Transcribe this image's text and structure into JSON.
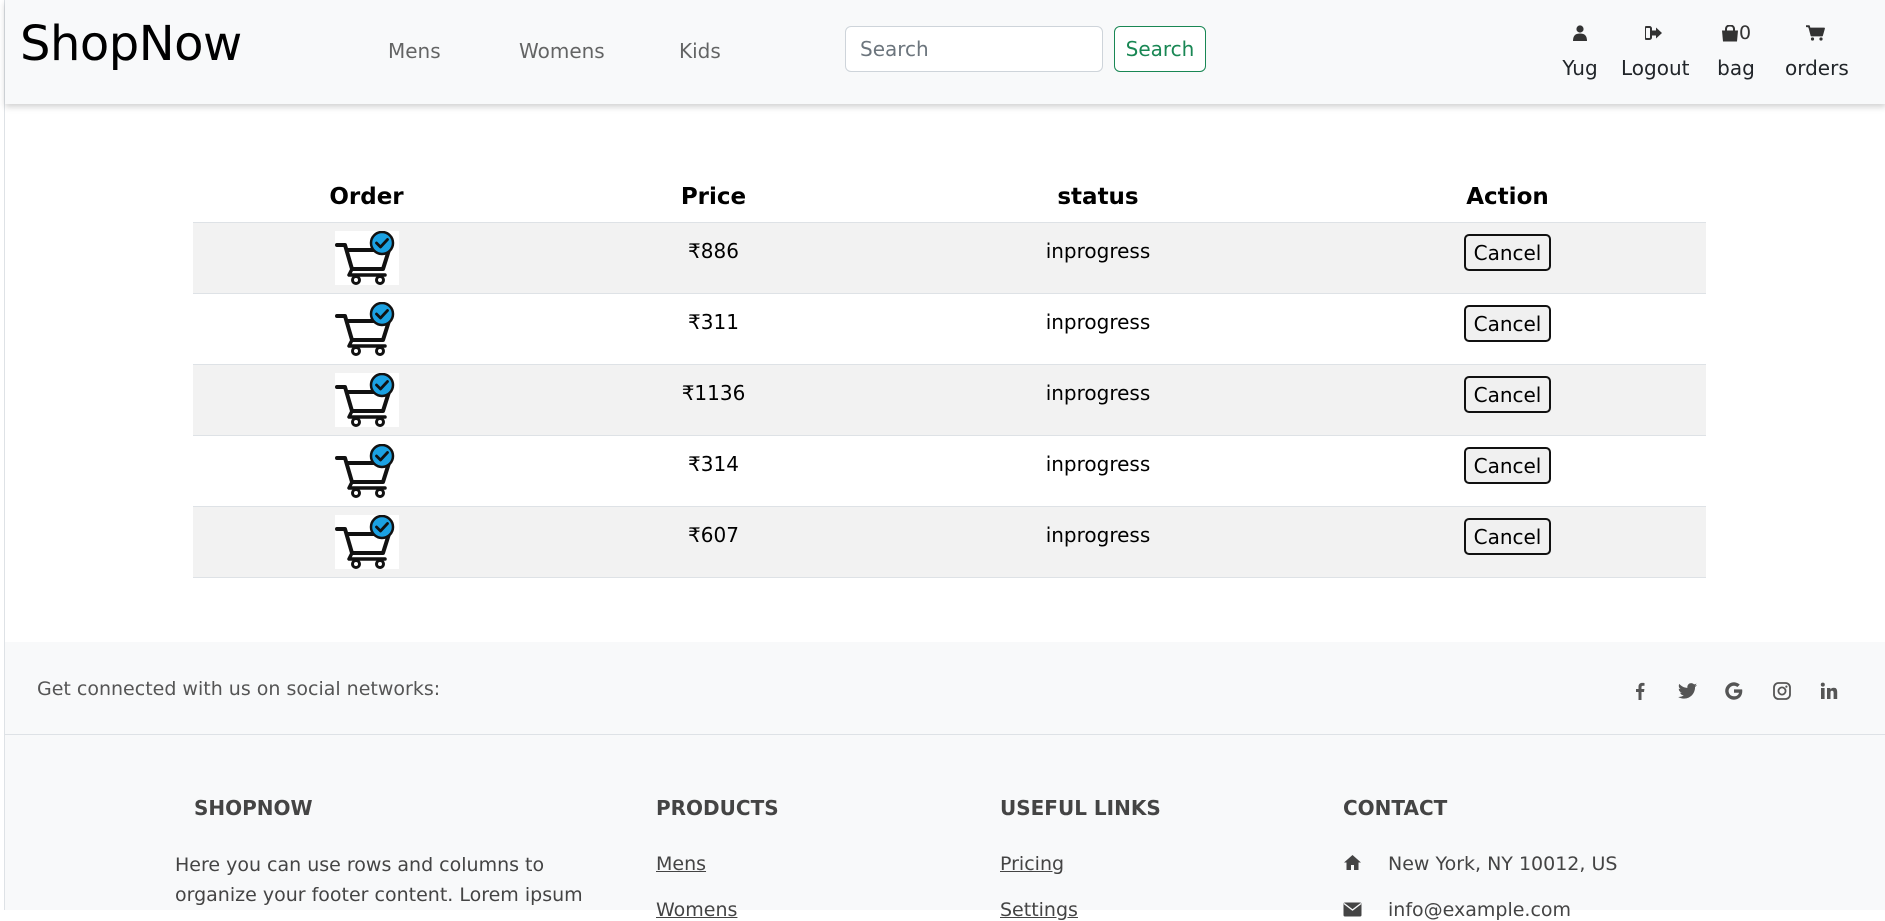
{
  "navbar": {
    "brand": "ShopNow",
    "links": [
      "Mens",
      "Womens",
      "Kids"
    ],
    "search": {
      "placeholder": "Search",
      "value": "",
      "button_label": "Search"
    },
    "user_menu": {
      "user_label": "Yug",
      "logout_label": "Logout",
      "bag_label": "bag",
      "bag_count": "0",
      "orders_label": "orders"
    }
  },
  "orders": {
    "columns": [
      "Order",
      "Price",
      "status",
      "Action"
    ],
    "rows": [
      {
        "price": "₹886",
        "status": "inprogress",
        "action": "Cancel"
      },
      {
        "price": "₹311",
        "status": "inprogress",
        "action": "Cancel"
      },
      {
        "price": "₹1136",
        "status": "inprogress",
        "action": "Cancel"
      },
      {
        "price": "₹314",
        "status": "inprogress",
        "action": "Cancel"
      },
      {
        "price": "₹607",
        "status": "inprogress",
        "action": "Cancel"
      }
    ]
  },
  "footer": {
    "social_text": "Get connected with us on social networks:",
    "social_icons": [
      "facebook-icon",
      "twitter-icon",
      "google-icon",
      "instagram-icon",
      "linkedin-icon"
    ],
    "sections": {
      "brand_title": "SHOPNOW",
      "brand_text": "Here you can use rows and columns to organize your footer content. Lorem ipsum",
      "products_title": "PRODUCTS",
      "products_links": [
        "Mens",
        "Womens"
      ],
      "useful_title": "USEFUL LINKS",
      "useful_links": [
        "Pricing",
        "Settings"
      ],
      "contact_title": "CONTACT",
      "contact_address": "New York, NY 10012, US",
      "contact_email": "info@example.com"
    }
  },
  "colors": {
    "navbar_bg": "#f8f9fa",
    "success": "#198754",
    "stripe": "#f2f2f2",
    "cart_check": "#1ba1e2"
  }
}
